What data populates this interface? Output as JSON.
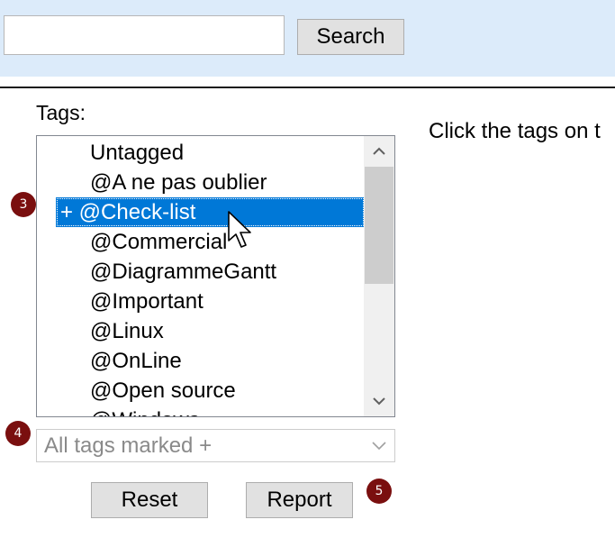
{
  "toolbar": {
    "search_value": "",
    "search_label": "Search"
  },
  "tags_label": "Tags:",
  "instructions": "Click the tags on t",
  "tag_list": {
    "items": [
      "Untagged",
      "@A ne pas oublier",
      "+ @Check-list",
      "@Commercial",
      "@DiagrammeGantt",
      "@Important",
      "@Linux",
      "@OnLine",
      "@Open source",
      "@Windows"
    ],
    "selected": "+ @Check-list"
  },
  "filter_select": {
    "value": "All tags marked +"
  },
  "buttons": {
    "reset": "Reset",
    "report": "Report"
  },
  "badges": {
    "list": "3",
    "filter": "4",
    "report": "5"
  },
  "colors": {
    "toolbar_bg": "#dcebfa",
    "selection": "#0078d7",
    "badge": "#7a0f0f"
  },
  "icons": [
    "chevron-up-icon",
    "chevron-down-icon",
    "dropdown-chevron-icon",
    "mouse-pointer-icon"
  ]
}
